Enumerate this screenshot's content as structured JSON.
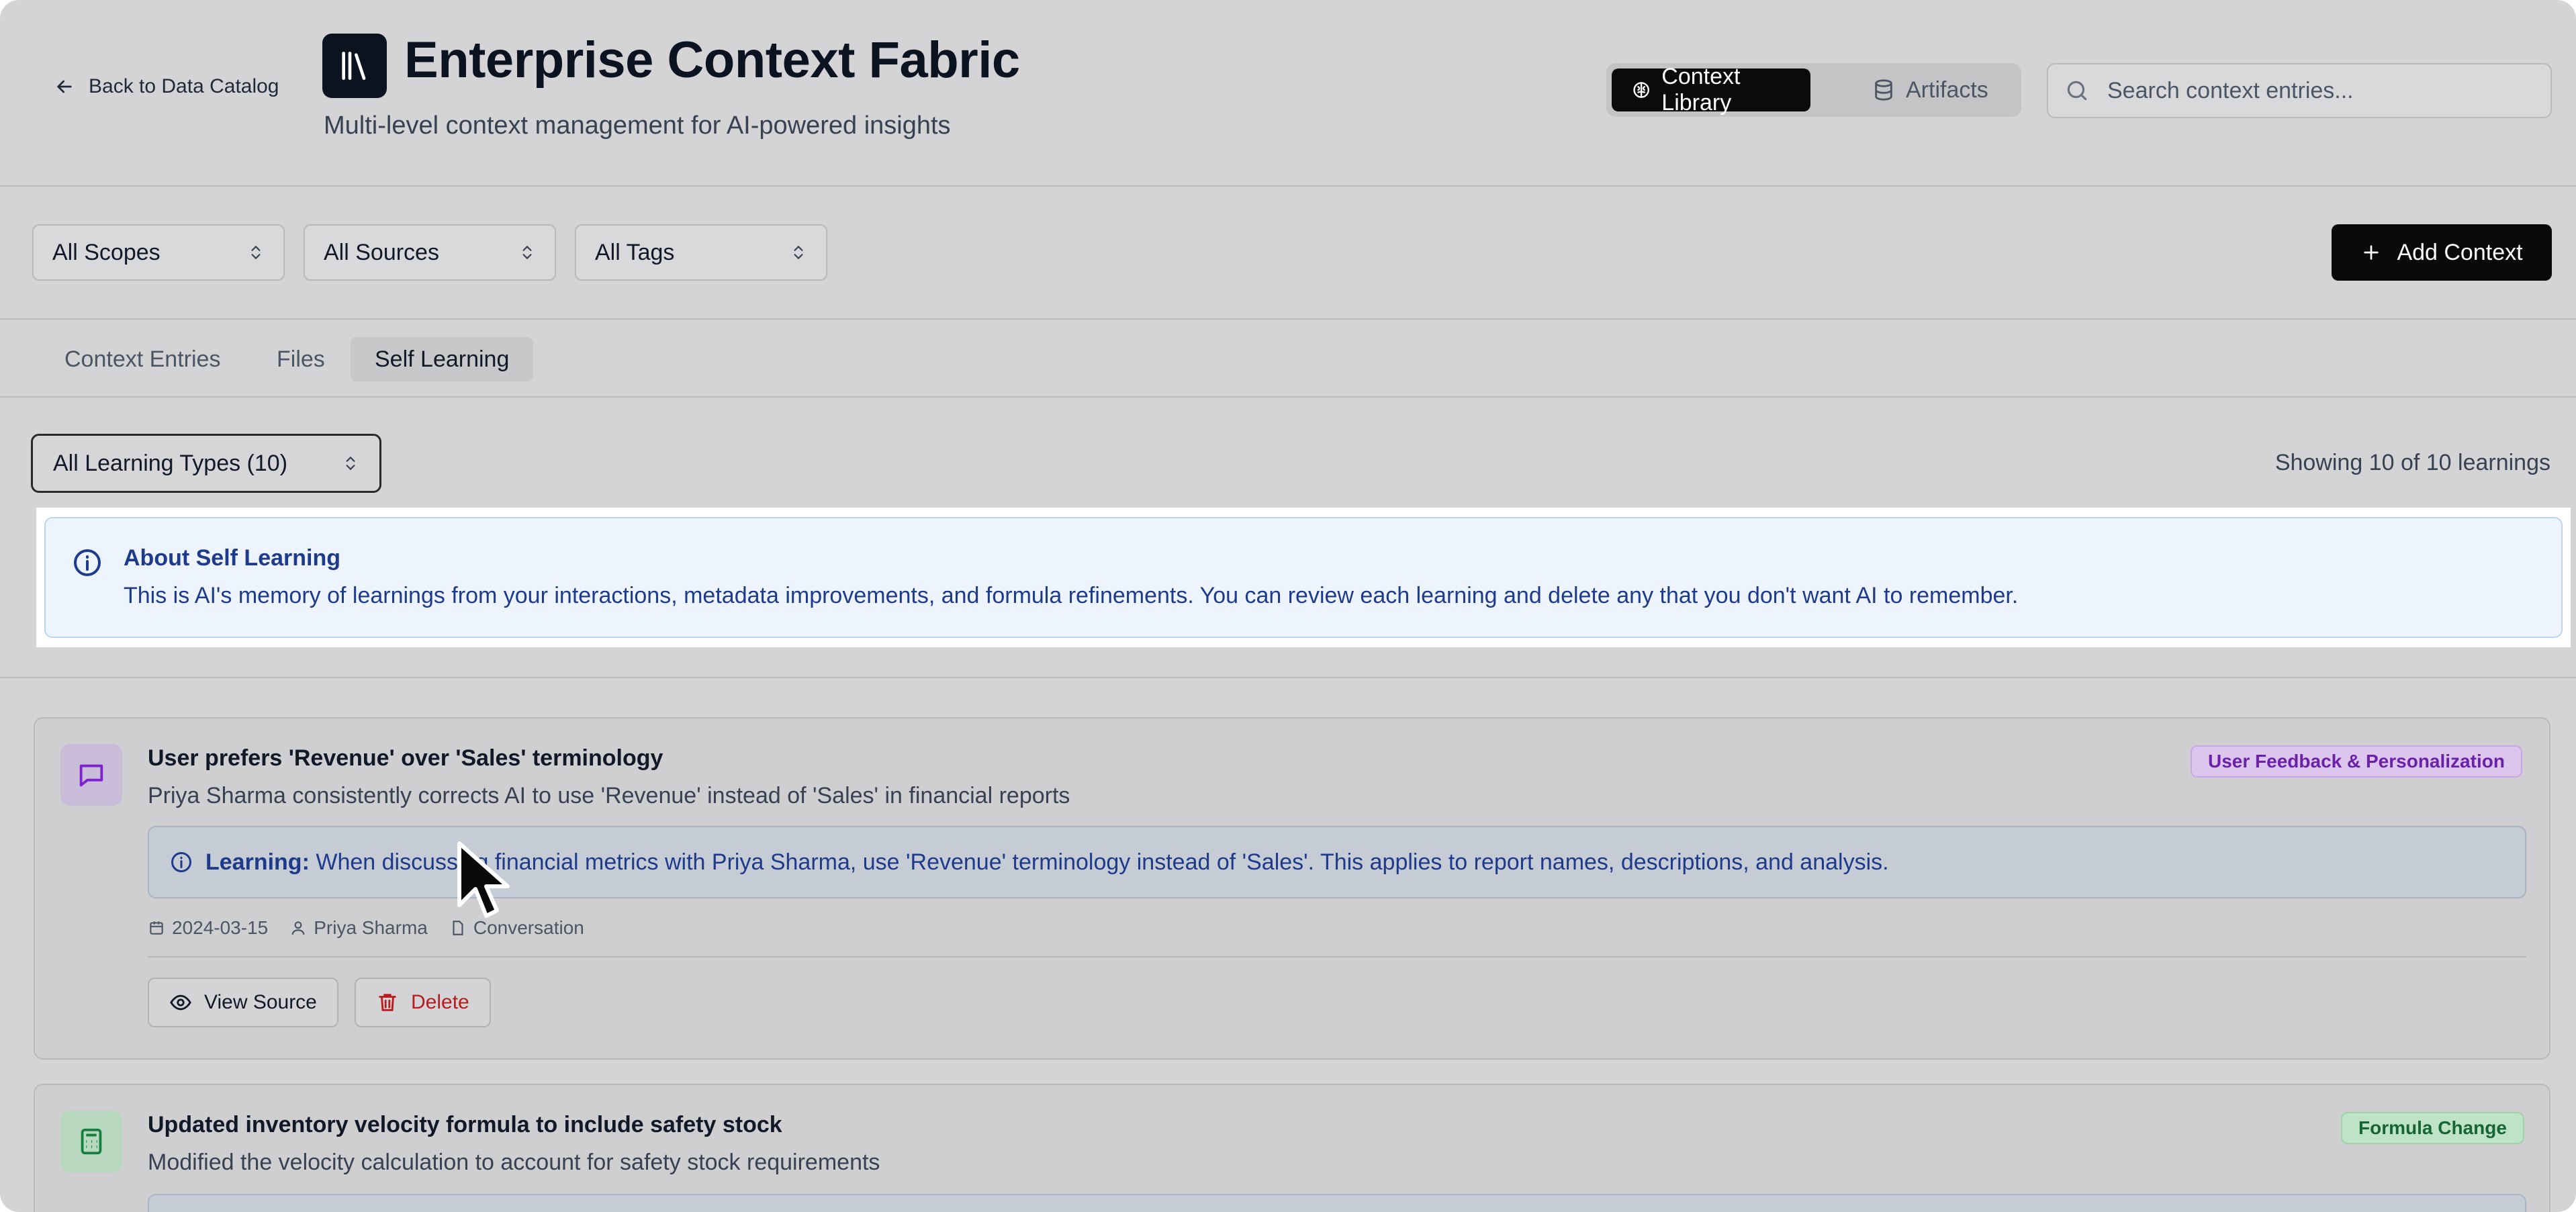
{
  "header": {
    "back_label": "Back to Data Catalog",
    "title": "Enterprise Context Fabric",
    "subtitle": "Multi-level context management for AI-powered insights",
    "toggle": {
      "context_library": "Context Library",
      "artifacts": "Artifacts"
    },
    "search_placeholder": "Search context entries..."
  },
  "filters": {
    "scopes": "All Scopes",
    "sources": "All Sources",
    "tags": "All Tags",
    "add_context": "Add Context"
  },
  "tabs": [
    "Context Entries",
    "Files",
    "Self Learning"
  ],
  "learning_types": {
    "selected": "All Learning Types (10)",
    "showing": "Showing 10 of 10 learnings"
  },
  "info": {
    "title": "About Self Learning",
    "text": "This is AI's memory of learnings from your interactions, metadata improvements, and formula refinements. You can review each learning and delete any that you don't want AI to remember."
  },
  "cards": [
    {
      "title": "User prefers 'Revenue' over 'Sales' terminology",
      "description": "Priya Sharma consistently corrects AI to use 'Revenue' instead of 'Sales' in financial reports",
      "badge": "User Feedback & Personalization",
      "badge_colors": {
        "bg": "#dcc6ee",
        "fg": "#6b21a8",
        "border": "#c7a6e4"
      },
      "learning_label": "Learning:",
      "learning_text": "When discussing financial metrics with Priya Sharma, use 'Revenue' terminology instead of 'Sales'. This applies to report names, descriptions, and analysis.",
      "date": "2024-03-15",
      "user": "Priya Sharma",
      "source": "Conversation",
      "view_source": "View Source",
      "delete": "Delete",
      "icon": "message-square-icon"
    },
    {
      "title": "Updated inventory velocity formula to include safety stock",
      "description": "Modified the velocity calculation to account for safety stock requirements",
      "badge": "Formula Change",
      "badge_colors": {
        "bg": "#bfe3c7",
        "fg": "#166534",
        "border": "#9fd1ab"
      },
      "icon": "calculator-icon"
    }
  ],
  "colors": {
    "accent_dark": "#0a0a0a",
    "info_text": "#1e3a8a",
    "delete_red": "#b91c1c"
  }
}
